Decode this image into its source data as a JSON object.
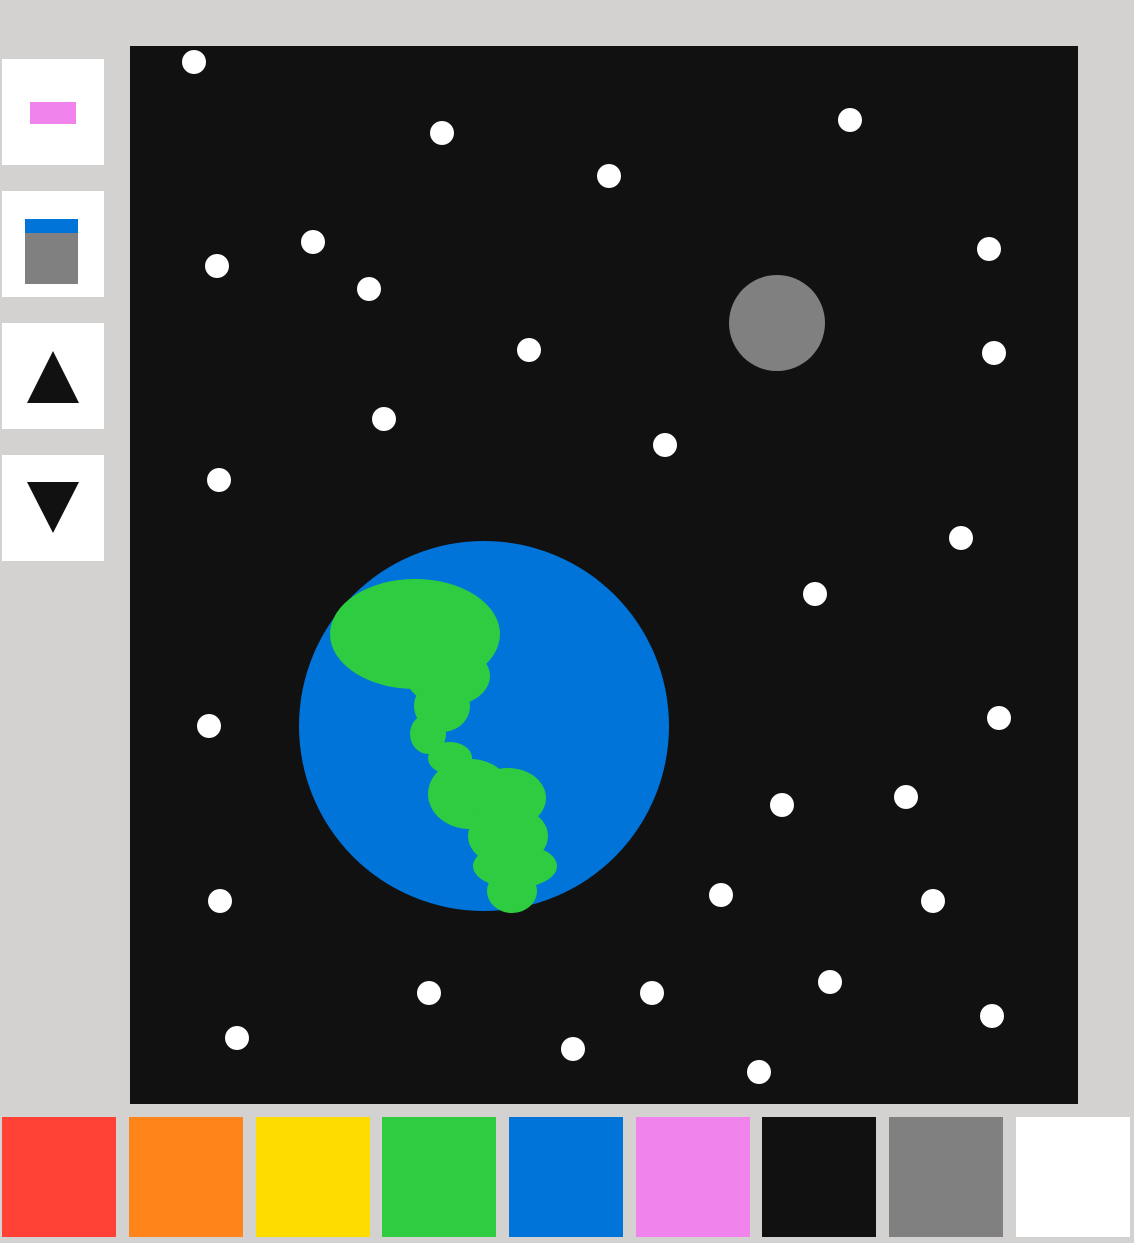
{
  "toolbar": {
    "tools": [
      {
        "id": "pink-bar-tool",
        "icon": "pink-bar-icon"
      },
      {
        "id": "fill-bucket-tool",
        "icon": "fill-bucket-icon"
      },
      {
        "id": "triangle-up-tool",
        "icon": "triangle-up-icon"
      },
      {
        "id": "triangle-down-tool",
        "icon": "triangle-down-icon"
      }
    ]
  },
  "canvas": {
    "background": "#111111",
    "star_color": "#ffffff",
    "moon_color": "#808080",
    "earth_ocean_color": "#0074d9",
    "earth_land_color": "#2ecc40"
  },
  "palette": {
    "colors": [
      "#ff4136",
      "#ff851b",
      "#ffdc00",
      "#2ecc40",
      "#0074d9",
      "#f084ec",
      "#111111",
      "#808080",
      "#ffffff"
    ]
  }
}
